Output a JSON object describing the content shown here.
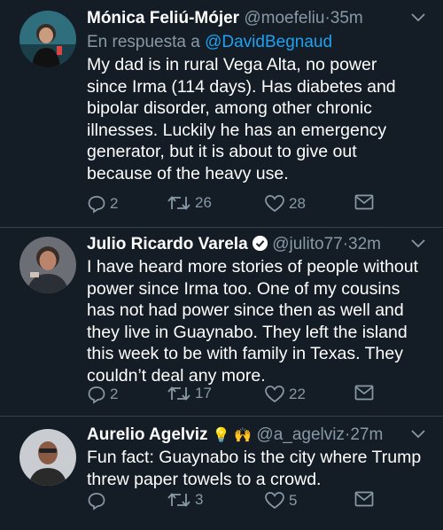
{
  "tweets": [
    {
      "name": "Mónica Feliú-Mójer",
      "handle": "@moefeliu",
      "time": "35m",
      "reply_prefix": "En respuesta a",
      "reply_to": "@DavidBegnaud",
      "lines": [
        "My dad is in rural Vega Alta, no power",
        "since Irma (114 days). Has diabetes and",
        "bipolar disorder, among other chronic",
        "illnesses. Luckily he has an emergency",
        "generator, but it is about to give out",
        "because of the heavy use."
      ],
      "replies": "2",
      "retweets": "26",
      "likes": "28"
    },
    {
      "name": "Julio Ricardo Varela",
      "handle": "@julito77",
      "time": "32m",
      "lines": [
        "I have heard more stories of people without",
        "power since Irma too. One of my cousins",
        "has not had power since then as well and",
        "they live in Guaynabo. They left the island",
        "this week to be with family in Texas. They",
        "couldn’t deal any more."
      ],
      "replies": "2",
      "retweets": "17",
      "likes": "22"
    },
    {
      "name": "Aurelio Agelviz",
      "emoji": "💡 🙌",
      "handle": "@a_agelviz",
      "time": "27m",
      "lines": [
        "Fun fact: Guaynabo is the city where Trump",
        "threw paper towels to a crowd."
      ],
      "replies": "",
      "retweets": "3",
      "likes": "5"
    }
  ],
  "colors": {
    "background": "#141d26",
    "secondary_text": "#8899a6",
    "link": "#1da1f2",
    "divider": "#38444d"
  },
  "icons": [
    "reply-icon",
    "retweet-icon",
    "like-icon",
    "dm-icon",
    "chevron-down-icon",
    "verified-icon"
  ]
}
